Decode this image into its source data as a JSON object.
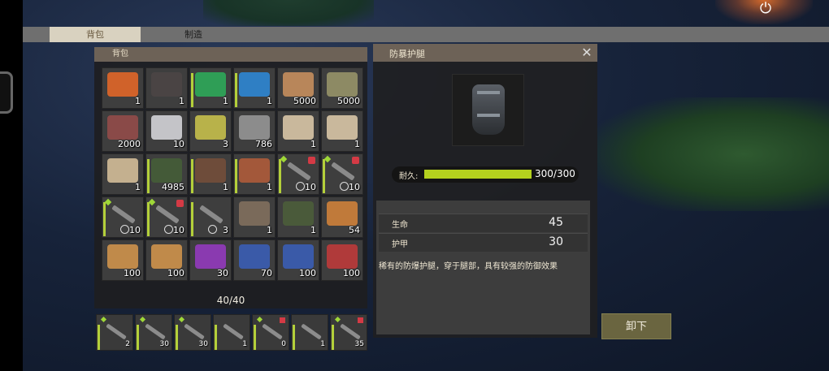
{
  "tabs": [
    {
      "label": "背包"
    },
    {
      "label": "制造"
    }
  ],
  "bag": {
    "header": "背包",
    "capacity": "40/40",
    "items": [
      {
        "icon": "kit-icon",
        "color": "#d0622a",
        "count": "1"
      },
      {
        "icon": "backpack-icon",
        "color": "#4a4444",
        "count": "1"
      },
      {
        "icon": "green-book-icon",
        "color": "#2f9e56",
        "count": "1",
        "dur": true
      },
      {
        "icon": "blue-book-icon",
        "color": "#2f7fc4",
        "count": "1",
        "dur": true
      },
      {
        "icon": "wood-logs-icon",
        "color": "#b8865a",
        "count": "5000"
      },
      {
        "icon": "stone-icon",
        "color": "#8d8a64",
        "count": "5000"
      },
      {
        "icon": "metal-plates-icon",
        "color": "#8a4a48",
        "count": "2000"
      },
      {
        "icon": "steel-bars-icon",
        "color": "#c4c4c8",
        "count": "10"
      },
      {
        "icon": "gold-ingots-icon",
        "color": "#b8b24a",
        "count": "3"
      },
      {
        "icon": "gears-icon",
        "color": "#8c8c8c",
        "count": "786"
      },
      {
        "icon": "blueprint-icon",
        "color": "#c9b89c",
        "count": "1"
      },
      {
        "icon": "blueprint-icon",
        "color": "#c9b89c",
        "count": "1"
      },
      {
        "icon": "blueprint-icon",
        "color": "#c4b08f",
        "count": "1"
      },
      {
        "icon": "grenade-icon",
        "color": "#445a38",
        "count": "4985",
        "dur": true
      },
      {
        "icon": "cleaver-icon",
        "color": "#6e4c3a",
        "count": "1",
        "dur": true
      },
      {
        "icon": "pickaxe-icon",
        "color": "#a3583a",
        "count": "1",
        "dur": true
      },
      {
        "icon": "rifle-icon",
        "color": "#8a8a8a",
        "count": "10",
        "dur": true,
        "weapon": true,
        "diamond": true,
        "mod": true
      },
      {
        "icon": "rifle-icon",
        "color": "#8a8a8a",
        "count": "10",
        "dur": true,
        "weapon": true,
        "diamond": true,
        "mod": true
      },
      {
        "icon": "rifle-icon",
        "color": "#8a8a8a",
        "count": "10",
        "dur": true,
        "weapon": true,
        "diamond": true
      },
      {
        "icon": "rifle-icon",
        "color": "#8a8a8a",
        "count": "10",
        "dur": true,
        "weapon": true,
        "diamond": true,
        "mod": true
      },
      {
        "icon": "shotgun-icon",
        "color": "#7a7a7a",
        "count": "3",
        "dur": true,
        "weapon": true
      },
      {
        "icon": "pipe-icon",
        "color": "#7a6a5a",
        "count": "1"
      },
      {
        "icon": "frag-grenade-icon",
        "color": "#4a5a3a",
        "count": "1"
      },
      {
        "icon": "ammo-icon",
        "color": "#c07a3a",
        "count": "54"
      },
      {
        "icon": "ammo-icon",
        "color": "#c08a4a",
        "count": "100"
      },
      {
        "icon": "ammo-icon",
        "color": "#c08a4a",
        "count": "100"
      },
      {
        "icon": "ammo-purple-icon",
        "color": "#8a3ab0",
        "count": "30"
      },
      {
        "icon": "ammo-blue-icon",
        "color": "#3a5aa8",
        "count": "70"
      },
      {
        "icon": "ammo-blue-icon",
        "color": "#3a5aa8",
        "count": "100"
      },
      {
        "icon": "ammo-red-icon",
        "color": "#b03a3a",
        "count": "100"
      }
    ]
  },
  "hotbar": [
    {
      "count": "2",
      "diamond": true
    },
    {
      "count": "30",
      "diamond": true
    },
    {
      "count": "30",
      "diamond": true
    },
    {
      "count": "1"
    },
    {
      "count": "0",
      "diamond": true,
      "mod": true
    },
    {
      "count": "1"
    },
    {
      "count": "35",
      "diamond": true,
      "mod": true
    }
  ],
  "detail": {
    "title": "防暴护腿",
    "close_icon": "close-icon",
    "durability_label": "耐久:",
    "durability_value": "300/300",
    "durability_fraction": 1.0,
    "stats": [
      {
        "name": "生命",
        "value": "45"
      },
      {
        "name": "护甲",
        "value": "30"
      }
    ],
    "description": "稀有的防爆护腿，穿于腿部，具有较强的防御效果"
  },
  "unload_button": "卸下",
  "colors": {
    "durability": "#b4d11e",
    "header": "#6d6257",
    "button": "#6a6540"
  }
}
